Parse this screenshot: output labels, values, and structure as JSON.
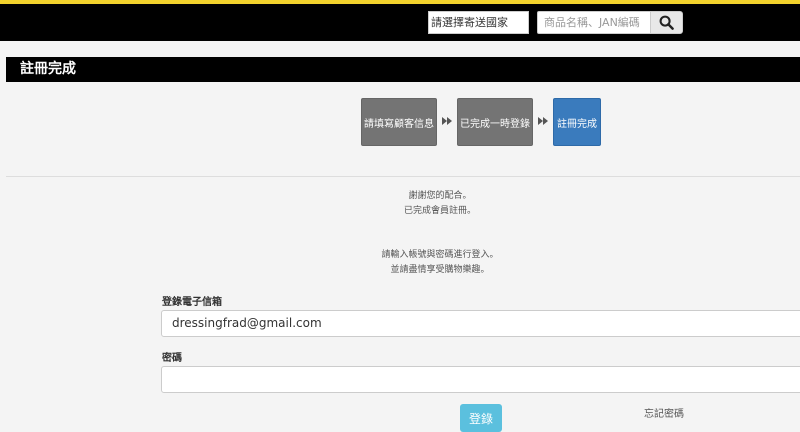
{
  "header": {
    "country_select": "請選擇寄送國家",
    "search_placeholder": "商品名稱、JAN編碼"
  },
  "page_title": "註冊完成",
  "steps": [
    {
      "label": "請填寫顧客信息"
    },
    {
      "label": "已完成一時登錄"
    },
    {
      "label": "註冊完成"
    }
  ],
  "messages": {
    "thanks_line1": "謝謝您的配合。",
    "thanks_line2": "已完成會員註冊。",
    "login_line1": "請輸入帳號與密碼進行登入。",
    "login_line2": "並請盡情享受購物樂趣。"
  },
  "form": {
    "email_label": "登錄電子信箱",
    "email_value": "dressingfrad@gmail.com",
    "password_label": "密碼",
    "password_value": "",
    "login_button": "登錄",
    "forgot_link": "忘記密碼"
  },
  "colors": {
    "accent_stripe": "#f2d22c",
    "active_step": "#3a7bbd",
    "login_button": "#5bc0de"
  }
}
